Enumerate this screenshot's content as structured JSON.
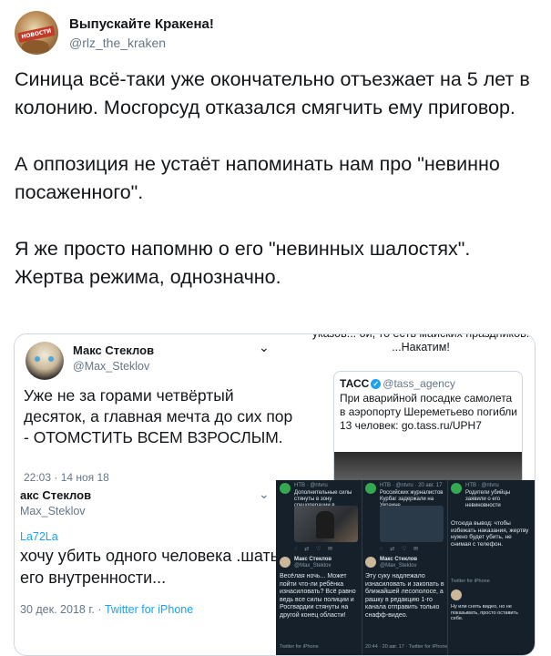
{
  "author": {
    "name": "Выпускайте Кракена!",
    "handle": "@rlz_the_kraken",
    "avatar_text": "НОВОСТИ"
  },
  "tweet": {
    "paragraphs": [
      "Синица всё-таки уже окончательно отъезжает на 5 лет в колонию. Мосгорсуд отказался смягчить ему приговор.",
      "А оппозиция не устаёт напоминать нам про \"невинно посаженного\".",
      "Я же просто напомню о его \"невинных шалостях\". Жертва режима, однозначно."
    ]
  },
  "media": {
    "panel1": {
      "name": "Макс Стеклов",
      "handle": "@Max_Steklov",
      "text": "Уже не за горами четвёртый десяток, а главная мечта до сих пор - ОТОМСТИТЬ ВСЕМ ВЗРОСЛЫМ.",
      "time": "22:03 · 14 ноя 18"
    },
    "panel2": {
      "name": "акс Стеклов",
      "handle": "Max_Steklov",
      "reply_to": "La72La",
      "text": "хочу убить одного человека .шать его внутренности...",
      "footer_date": "30 дек. 2018 г. · ",
      "footer_source": "Twitter for iPhone"
    },
    "panel3": {
      "top_text": "указов... ой, то есть майских праздников! ...Накатим!",
      "card_name": "ТАСС",
      "card_handle": "@tass_agency",
      "card_text": "При аварийной посадке самолета в аэропорту Шереметьево погибли 13 человек: go.tass.ru/UPH7"
    },
    "panel4": {
      "col1": {
        "header": "НТВ · @ntvru",
        "summary": "Дополнительные силы стянуты в зону спецоперации в Подмосковье",
        "reply_name": "Макс Стеклов",
        "reply_handle": "@Max_Steklov",
        "reply_text": "Весёлая ночь... Может пойти что-ли ребёнка изнасиловать? Всё равно ведь все силы полиции и Росгвардии стянуты на другой конец области!",
        "footer": "Twitter for iPhone"
      },
      "col2": {
        "header": "НТВ · @ntvru · 20 авг. 17",
        "summary": "Российских журналистов Курбаг задержали на Украине",
        "reply_name": "Макс Стеклов",
        "reply_handle": "@Max_Steklov",
        "reply_text": "Эту суку надлежало изнасиловать и закопать в ближайшей лесополосе, а рашку в редакцию 1-го канала отправить только снафф-видео.",
        "footer": "20:44 · 20 авг. 17 · Twitter for iPhone"
      },
      "col3": {
        "header": "НТВ · @ntvru",
        "summary": "Родители убийцы заявили о его невиновности",
        "reply_text": "Отсюда вывод: чтобы избежать наказания, жертву нужно будет убить, не снимая с телефон.",
        "footer": "Twitter for iPhone",
        "reply_text2": "Ну или снять видео, но не показывать, просто оставить себе."
      }
    }
  }
}
